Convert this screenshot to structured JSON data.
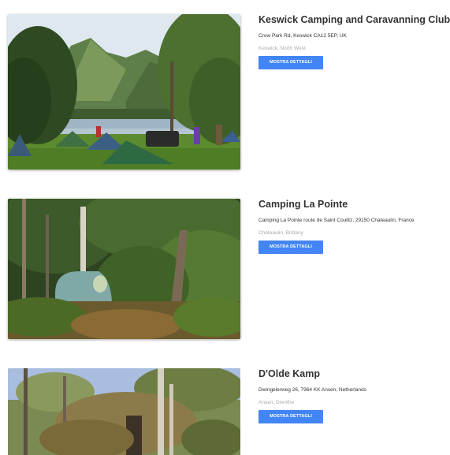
{
  "listings": [
    {
      "title": "Keswick Camping and Caravanning Club Site",
      "address": "Crow Park Rd, Keswick CA12 5EP, UK",
      "region": "Keswick, North West",
      "button_label": "MOSTRA DETTAGLI"
    },
    {
      "title": "Camping La Pointe",
      "address": "Camping La Pointe route de Saint Coulitz, 29150 Chateaulin, France",
      "region": "Chateaulin, Brittany",
      "button_label": "MOSTRA DETTAGLI"
    },
    {
      "title": "D'Olde Kamp",
      "address": "Dwingelerweg 26, 7964 KK Ansen, Netherlands",
      "region": "Ansen, Drenthe",
      "button_label": "MOSTRA DETTAGLI"
    }
  ],
  "colors": {
    "button": "#4285f4",
    "title": "#333333",
    "region": "#aaaaaa"
  }
}
